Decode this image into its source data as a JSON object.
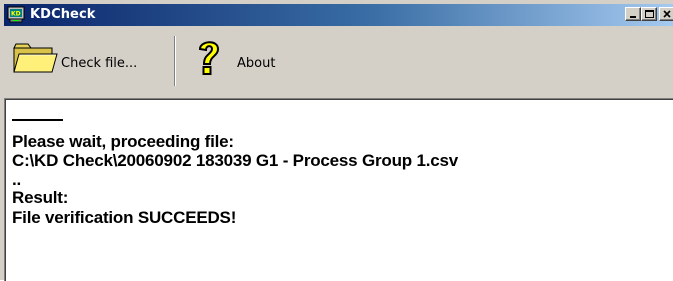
{
  "window": {
    "title": "KDCheck",
    "icon": "kd-app-icon",
    "controls": [
      "minimize",
      "maximize",
      "close"
    ]
  },
  "toolbar": {
    "check_file_label": "Check file...",
    "check_file_icon": "folder-icon",
    "about_label": "About",
    "about_icon": "question-mark-icon"
  },
  "log": {
    "separator": "————",
    "lines": [
      "Please wait, proceeding file:",
      "C:\\KD Check\\20060902 183039 G1 - Process Group 1.csv",
      "..",
      "Result:",
      "File verification SUCCEEDS!"
    ]
  }
}
